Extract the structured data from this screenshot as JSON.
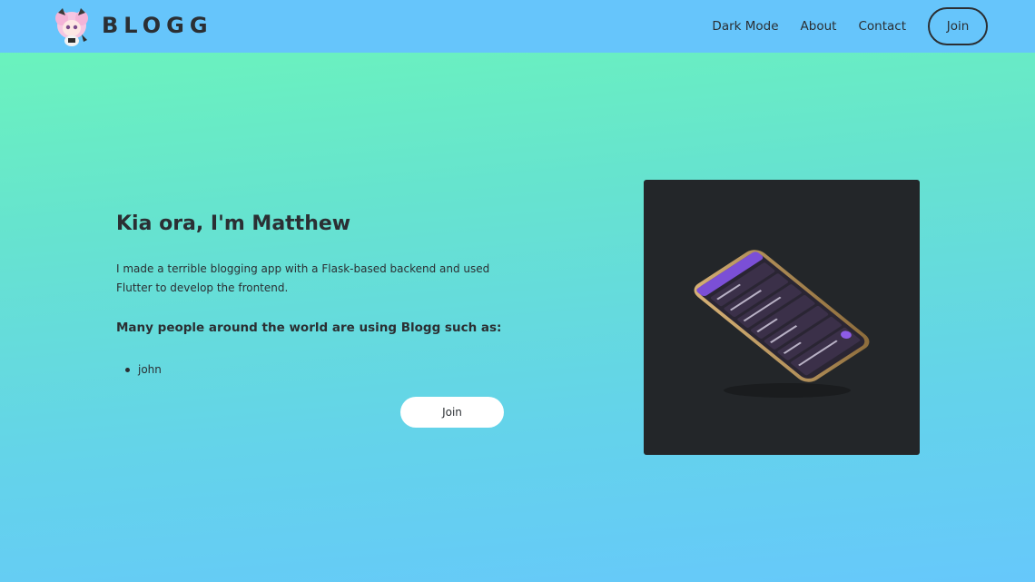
{
  "header": {
    "brand": "BLOGG",
    "logo_icon": "anime-avatar-icon",
    "nav": {
      "dark_mode": "Dark Mode",
      "about": "About",
      "contact": "Contact",
      "join": "Join"
    },
    "background": "#66c5fb"
  },
  "hero": {
    "title": "Kia ora, I'm Matthew",
    "description": "I made a terrible blogging app with a Flask-based backend and used Flutter to develop the frontend.",
    "users_heading": "Many people around the world are using Blogg such as:",
    "users": [
      "john"
    ],
    "join_label": "Join"
  },
  "showcase": {
    "image_icon": "phone-app-screenshot",
    "background": "#232629",
    "accent": "#7b4fd6"
  },
  "colors": {
    "text": "#2b2f33",
    "gradient_top": "#6cf7b8",
    "gradient_bottom": "#66c8fb"
  }
}
